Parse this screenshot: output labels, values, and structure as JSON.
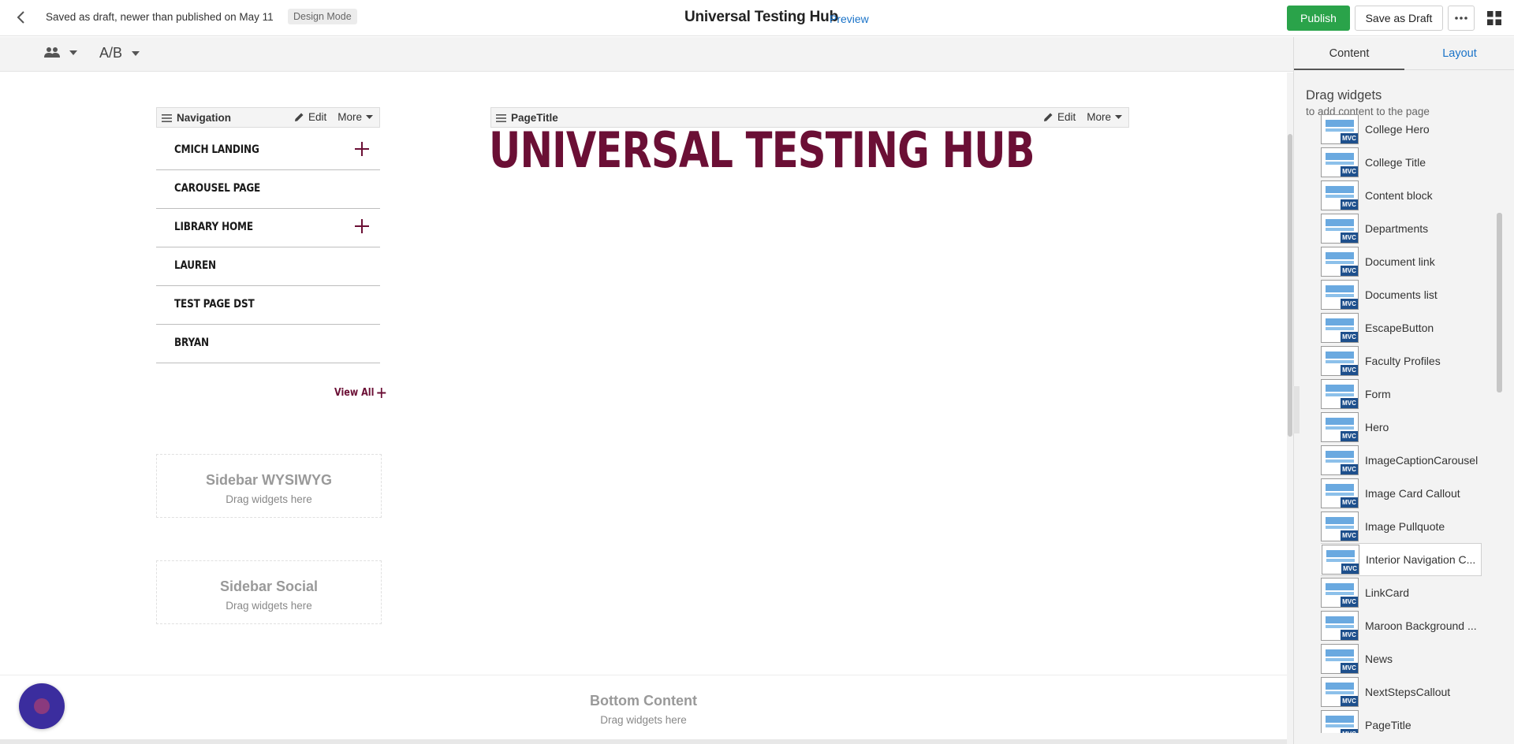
{
  "topbar": {
    "status": "Saved as draft, newer than published on May 11",
    "mode": "Design Mode",
    "title": "Universal Testing Hub",
    "preview": "Preview",
    "publish": "Publish",
    "save_draft": "Save as Draft"
  },
  "toolbar": {
    "ab": "A/B"
  },
  "nav_widget": {
    "label": "Navigation",
    "edit": "Edit",
    "more": "More",
    "items": [
      {
        "label": "CMICH LANDING",
        "expandable": true
      },
      {
        "label": "CAROUSEL PAGE",
        "expandable": false
      },
      {
        "label": "LIBRARY HOME",
        "expandable": true
      },
      {
        "label": "LAUREN",
        "expandable": false
      },
      {
        "label": "TEST PAGE DST",
        "expandable": false
      },
      {
        "label": "BRYAN",
        "expandable": false
      }
    ],
    "view_all": "View All"
  },
  "title_widget": {
    "label": "PageTitle",
    "edit": "Edit",
    "more": "More",
    "heading": "UNIVERSAL TESTING HUB"
  },
  "zones": {
    "sidebar_wysiwyg": {
      "title": "Sidebar WYSIWYG",
      "hint": "Drag widgets here"
    },
    "sidebar_social": {
      "title": "Sidebar Social",
      "hint": "Drag widgets here"
    },
    "bottom_content": {
      "title": "Bottom Content",
      "hint": "Drag widgets here"
    }
  },
  "panel": {
    "tabs": [
      "Content",
      "Layout"
    ],
    "drag_title": "Drag widgets",
    "drag_sub": "to add content to the page",
    "badge": "MVC",
    "widgets": [
      "College Hero",
      "College Title",
      "Content block",
      "Departments",
      "Document link",
      "Documents list",
      "EscapeButton",
      "Faculty Profiles",
      "Form",
      "Hero",
      "ImageCaptionCarousel",
      "Image Card Callout",
      "Image Pullquote",
      "Interior Navigation C...",
      "LinkCard",
      "Maroon Background ...",
      "News",
      "NextStepsCallout",
      "PageTitle"
    ],
    "highlighted_widget": "Interior Navigation C..."
  },
  "colors": {
    "maroon": "#6b0f35",
    "publish_green": "#2aa34a",
    "link_blue": "#1a73c8",
    "icon_blue": "#6aa9e0",
    "mvc_navy": "#1d4f8c"
  },
  "icons": [
    "back-arrow-icon",
    "ellipsis-icon",
    "grid-icon",
    "users-icon",
    "caret-down-icon",
    "drag-handle-icon",
    "pencil-icon",
    "plus-icon",
    "widget-thumbnail-icon"
  ]
}
